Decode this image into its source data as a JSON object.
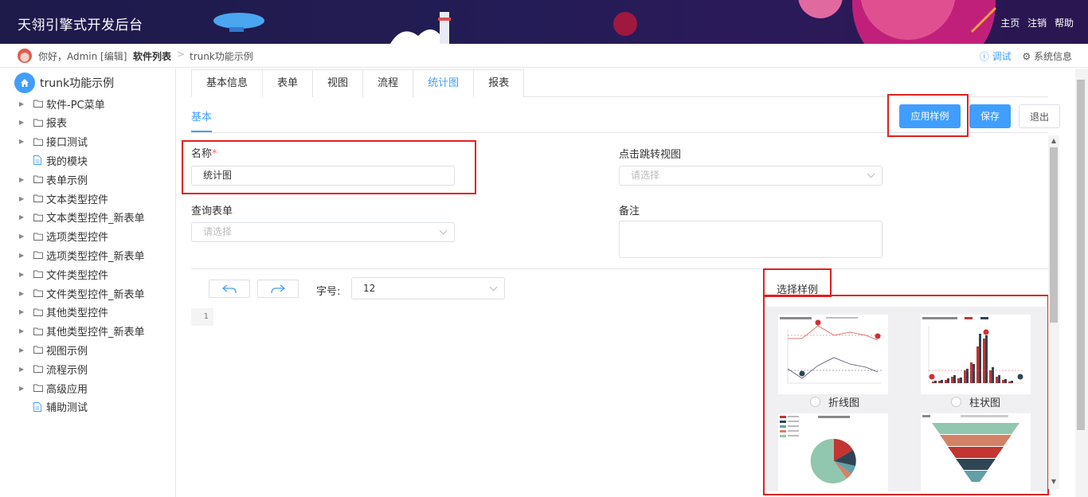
{
  "header": {
    "title": "天翎引擎式开发后台",
    "links": [
      "主页",
      "注销",
      "帮助"
    ]
  },
  "breadcrumb": {
    "greeting": "你好，Admin [编辑]",
    "crumb1": "软件列表",
    "separator": ">",
    "crumb2": "trunk功能示例",
    "debug": "ⓘ 调试",
    "sysinfo": "⚙ 系统信息"
  },
  "sidebar": {
    "root": "trunk功能示例",
    "items": [
      {
        "label": "软件-PC菜单",
        "type": "folder"
      },
      {
        "label": "报表",
        "type": "folder"
      },
      {
        "label": "接口测试",
        "type": "folder"
      },
      {
        "label": "我的模块",
        "type": "file"
      },
      {
        "label": "表单示例",
        "type": "folder"
      },
      {
        "label": "文本类型控件",
        "type": "folder"
      },
      {
        "label": "文本类型控件_新表单",
        "type": "folder"
      },
      {
        "label": "选项类型控件",
        "type": "folder"
      },
      {
        "label": "选项类型控件_新表单",
        "type": "folder"
      },
      {
        "label": "文件类型控件",
        "type": "folder"
      },
      {
        "label": "文件类型控件_新表单",
        "type": "folder"
      },
      {
        "label": "其他类型控件",
        "type": "folder"
      },
      {
        "label": "其他类型控件_新表单",
        "type": "folder"
      },
      {
        "label": "视图示例",
        "type": "folder"
      },
      {
        "label": "流程示例",
        "type": "folder"
      },
      {
        "label": "高级应用",
        "type": "folder"
      },
      {
        "label": "辅助测试",
        "type": "file"
      }
    ]
  },
  "tabs": [
    "基本信息",
    "表单",
    "视图",
    "流程",
    "统计图",
    "报表"
  ],
  "active_tab": "统计图",
  "subtab": "基本",
  "buttons": {
    "apply_sample": "应用样例",
    "save": "保存",
    "exit": "退出"
  },
  "form": {
    "name_label": "名称",
    "required_mark": "*",
    "name_value": "统计图",
    "jump_view_label": "点击跳转视图",
    "jump_view_placeholder": "请选择",
    "query_form_label": "查询表单",
    "query_form_placeholder": "请选择",
    "remark_label": "备注"
  },
  "editor": {
    "font_size_label": "字号:",
    "font_size_value": "12",
    "line_number": "1"
  },
  "samples": {
    "title": "选择样例",
    "options": [
      "折线图",
      "柱状图"
    ]
  },
  "colors": {
    "accent": "#409eff",
    "highlight": "#e02020"
  }
}
